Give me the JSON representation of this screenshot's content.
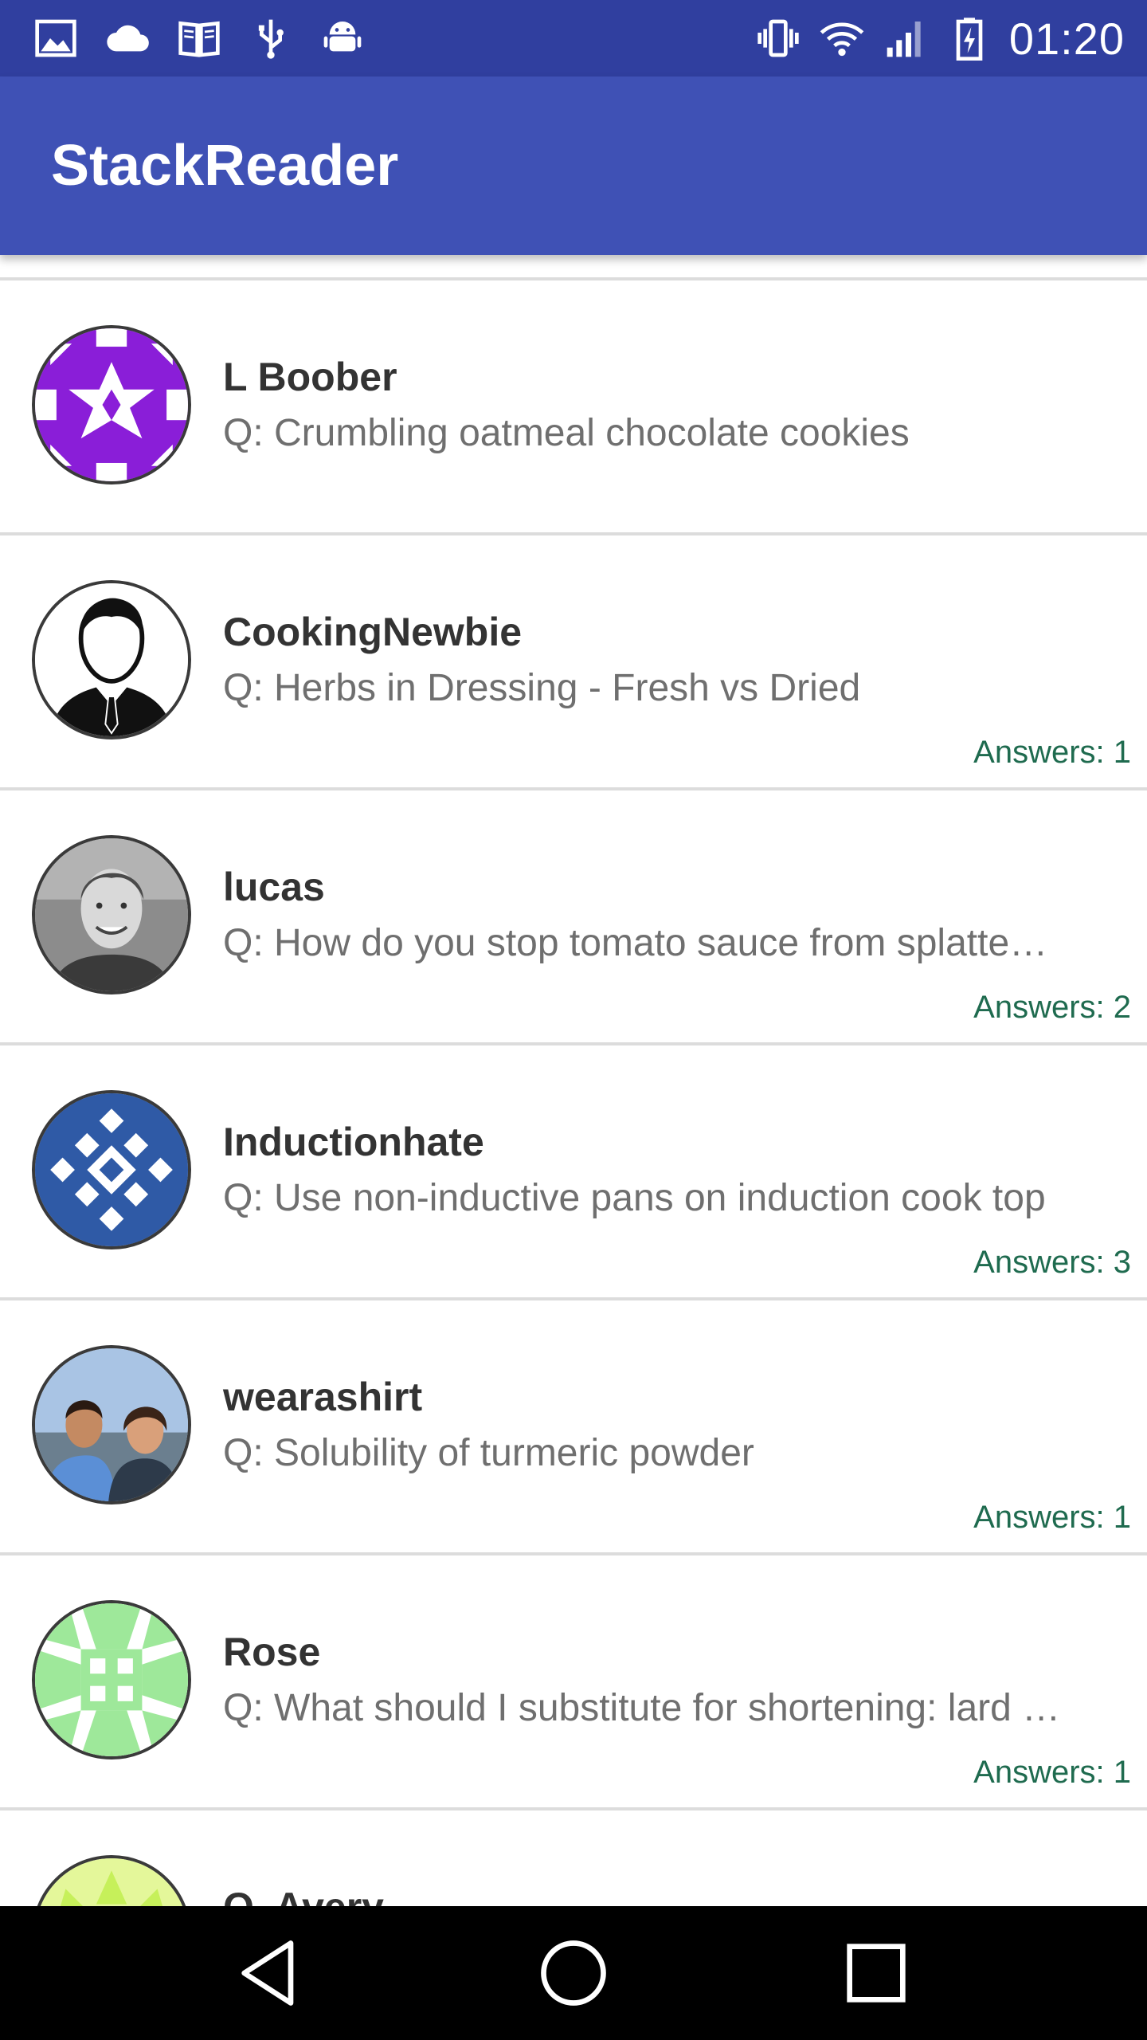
{
  "status_bar": {
    "time": "01:20",
    "left_icons": [
      "image-icon",
      "cloud-icon",
      "book-icon",
      "usb-icon",
      "android-icon"
    ],
    "right_icons": [
      "vibrate-icon",
      "wifi-icon",
      "signal-icon",
      "battery-charging-icon"
    ]
  },
  "app_bar": {
    "title": "StackReader"
  },
  "questions": [
    {
      "user": "L Boober",
      "question": "Q: Crumbling oatmeal chocolate cookies",
      "answers": ""
    },
    {
      "user": "CookingNewbie",
      "question": "Q: Herbs in Dressing - Fresh vs Dried",
      "answers": "Answers: 1"
    },
    {
      "user": "lucas",
      "question": "Q: How do you stop tomato sauce from splatte…",
      "answers": "Answers: 2"
    },
    {
      "user": "Inductionhate",
      "question": "Q: Use non-inductive pans on induction cook top",
      "answers": "Answers: 3"
    },
    {
      "user": "wearashirt",
      "question": "Q: Solubility of turmeric powder",
      "answers": "Answers: 1"
    },
    {
      "user": "Rose",
      "question": "Q: What should I substitute for shortening: lard …",
      "answers": "Answers: 1"
    },
    {
      "user": "Q. Avery",
      "question": "",
      "answers": ""
    }
  ],
  "nav_bar": {
    "buttons": [
      "back-icon",
      "home-icon",
      "recents-icon"
    ]
  },
  "colors": {
    "status_bar": "#303F9F",
    "app_bar": "#3F51B5",
    "answers_text": "#1f6b4f",
    "name_text": "#333333",
    "question_text": "#6f6f6f"
  }
}
